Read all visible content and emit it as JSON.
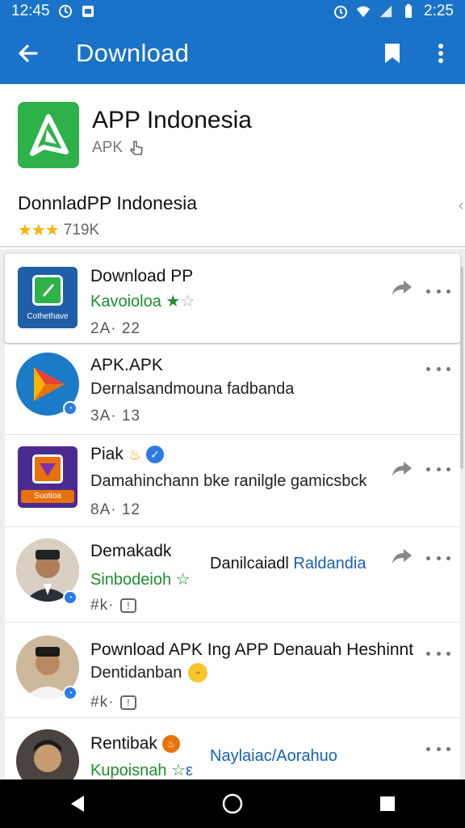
{
  "status_bar": {
    "left_time": "12:45",
    "right_time": "2:25"
  },
  "app_bar": {
    "title": "Download",
    "icons": [
      "back-arrow-icon",
      "bookmark-icon",
      "more-vert-icon"
    ]
  },
  "header": {
    "app_name": "APP Indonesia",
    "app_type": "APK",
    "line": "DonnladPP Indonesia",
    "rating_stars": 3,
    "rating_count": "719K",
    "edge_mark": "‹"
  },
  "list": [
    {
      "title": "Download PP",
      "subtitle": "Kavoioloa",
      "meta": "2A· 22",
      "highlighted": true,
      "share": true,
      "avatar_label": "Cothethave"
    },
    {
      "title": "APK.APK",
      "subtitle": "Dernalsandmouna fadbanda",
      "meta": "3A· 13",
      "share": false
    },
    {
      "title": "Piak",
      "subtitle": "Damahinchann bke ranilgle gamicsbck",
      "meta": "8A· 12",
      "share": true,
      "avatar_label": "Suotioa"
    },
    {
      "title": "Demakadk",
      "subtitle": "Sinbodeioh",
      "inline_text": "Danilcaiadl",
      "inline_link": "Raldandia",
      "meta": "#k·",
      "share": true
    },
    {
      "title": "Pownload APK Ing APP Denauah Heshinnt",
      "subtitle": "Dentidanban",
      "meta": "#k·",
      "share": false
    },
    {
      "title": "Rentibak",
      "subtitle": "Kupoisnah",
      "inline_link": "Naylaiac/Aorahuo",
      "share": false
    }
  ],
  "colors": {
    "primary": "#1a73c8",
    "green": "#2fb14a",
    "star": "#f4b400",
    "link": "#1a5fb4"
  }
}
